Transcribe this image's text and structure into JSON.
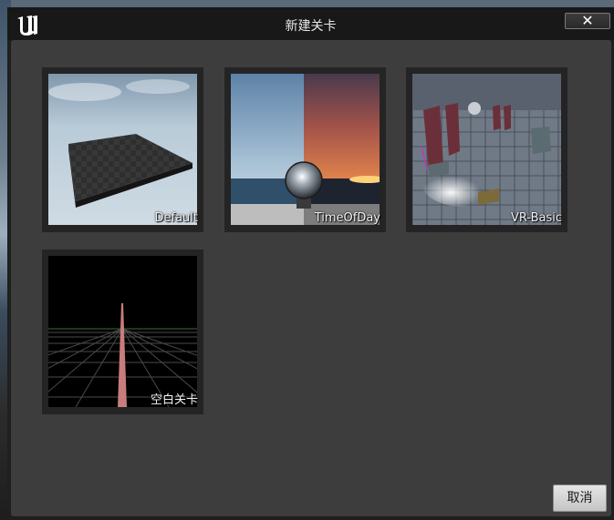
{
  "window": {
    "title": "新建关卡",
    "close_label": "✕"
  },
  "templates": [
    {
      "label": "Default"
    },
    {
      "label": "TimeOfDay"
    },
    {
      "label": "VR-Basic"
    },
    {
      "label": "空白关卡"
    }
  ],
  "footer": {
    "cancel_label": "取消"
  }
}
